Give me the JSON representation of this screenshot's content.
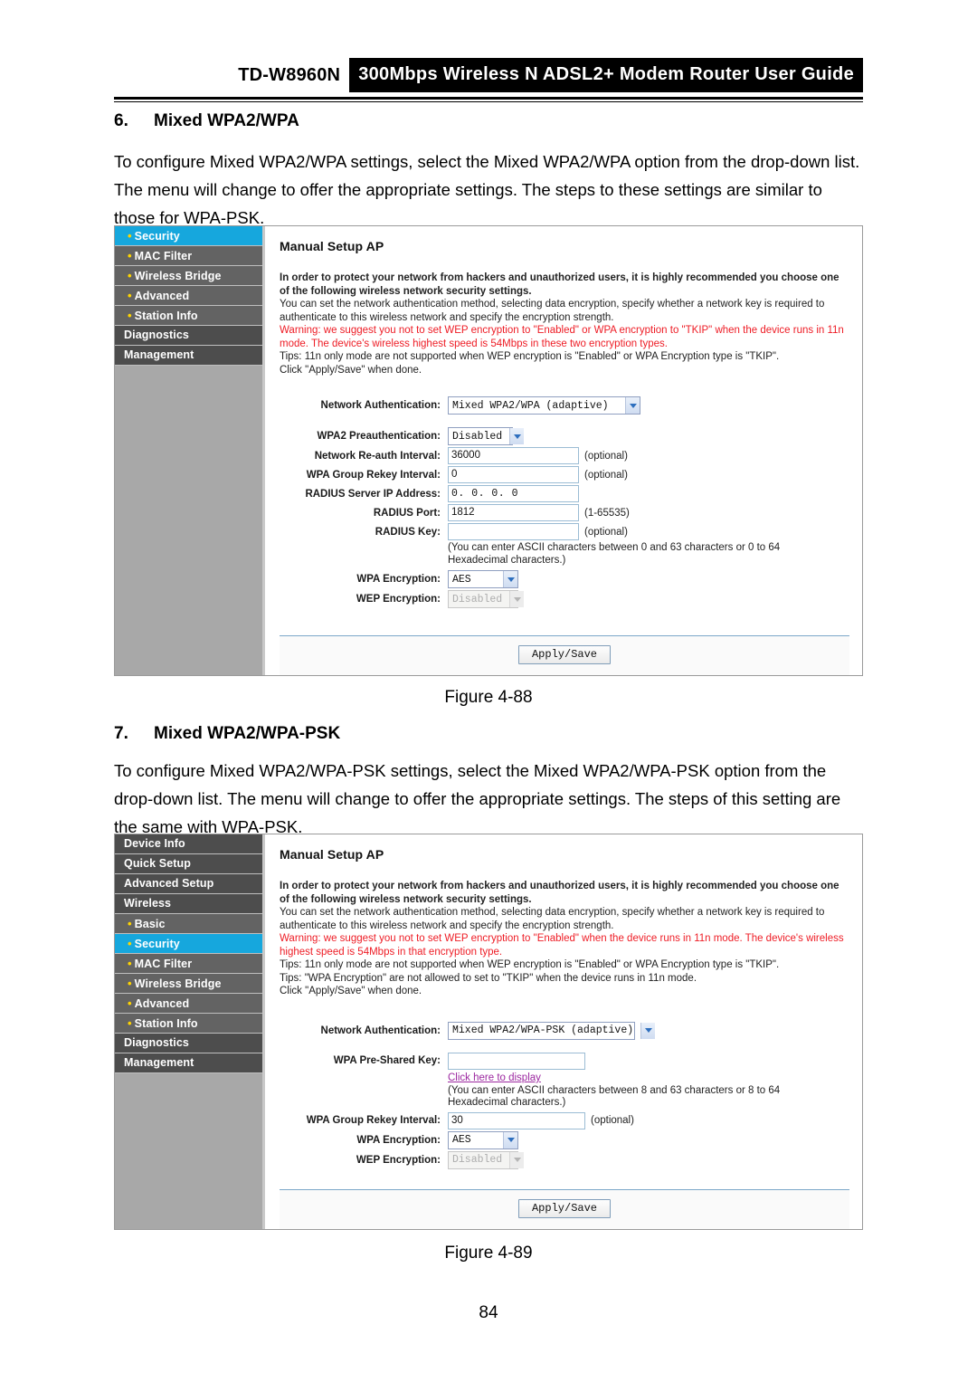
{
  "header": {
    "model": "TD-W8960N",
    "banner": "300Mbps Wireless N ADSL2+ Modem Router User Guide"
  },
  "page_number": "84",
  "sections": [
    {
      "number": "6.",
      "title": "Mixed WPA2/WPA",
      "paragraph": "To configure Mixed WPA2/WPA settings, select the Mixed WPA2/WPA option from the drop-down list. The menu will change to offer the appropriate settings. The steps to these settings are similar to those for WPA-PSK.",
      "figure_caption": "Figure 4-88"
    },
    {
      "number": "7.",
      "title": "Mixed WPA2/WPA-PSK",
      "paragraph": "To configure Mixed WPA2/WPA-PSK settings, select the Mixed WPA2/WPA-PSK option from the drop-down list. The menu will change to offer the appropriate settings. The steps of this setting are the same with WPA-PSK.",
      "figure_caption": "Figure 4-89"
    }
  ],
  "figure88": {
    "sidebar": [
      {
        "label": "Security",
        "sub": true,
        "active": true
      },
      {
        "label": "MAC Filter",
        "sub": true,
        "active": false
      },
      {
        "label": "Wireless Bridge",
        "sub": true,
        "active": false
      },
      {
        "label": "Advanced",
        "sub": true,
        "active": false
      },
      {
        "label": "Station Info",
        "sub": true,
        "active": false
      },
      {
        "label": "Diagnostics",
        "sub": false,
        "active": false
      },
      {
        "label": "Management",
        "sub": false,
        "active": false
      }
    ],
    "panel_title": "Manual Setup AP",
    "blurb": {
      "bold_line": "In order to protect your network from hackers and unauthorized users, it is highly recommended you choose one of the following wireless network security settings.",
      "line2": "You can set the network authentication method, selecting data encryption, specify whether a network key is required to authenticate to this wireless network and specify the encryption strength.",
      "warning": "Warning: we suggest you not to set WEP encryption to \"Enabled\" or WPA encryption to \"TKIP\" when the device runs in 11n mode. The device's wireless highest speed is 54Mbps in these two encryption types.",
      "tip1": "Tips: 11n only mode are not supported when WEP encryption is \"Enabled\" or WPA Encryption type is \"TKIP\".",
      "click": "Click \"Apply/Save\" when done."
    },
    "fields": {
      "network_auth_label": "Network Authentication:",
      "network_auth_value": "Mixed WPA2/WPA (adaptive)",
      "wpa2_preauth_label": "WPA2 Preauthentication:",
      "wpa2_preauth_value": "Disabled",
      "reauth_label": "Network Re-auth Interval:",
      "reauth_value": "36000",
      "reauth_hint": "(optional)",
      "rekey_label": "WPA Group Rekey Interval:",
      "rekey_value": "0",
      "rekey_hint": "(optional)",
      "radius_ip_label": "RADIUS Server IP Address:",
      "radius_ip_value": "0. 0. 0. 0",
      "radius_port_label": "RADIUS Port:",
      "radius_port_value": "1812",
      "radius_port_hint": "(1-65535)",
      "radius_key_label": "RADIUS Key:",
      "radius_key_value": "",
      "radius_key_hint": "(optional)",
      "ascii_note_line1": "(You can enter ASCII characters between 0 and 63 characters or 0 to 64",
      "ascii_note_line2": "Hexadecimal characters.)",
      "wpa_enc_label": "WPA Encryption:",
      "wpa_enc_value": "AES",
      "wep_enc_label": "WEP Encryption:",
      "wep_enc_value": "Disabled"
    },
    "apply_button": "Apply/Save"
  },
  "figure89": {
    "sidebar": [
      {
        "label": "Device Info",
        "sub": false,
        "active": false
      },
      {
        "label": "Quick Setup",
        "sub": false,
        "active": false
      },
      {
        "label": "Advanced Setup",
        "sub": false,
        "active": false
      },
      {
        "label": "Wireless",
        "sub": false,
        "active": false
      },
      {
        "label": "Basic",
        "sub": true,
        "active": false
      },
      {
        "label": "Security",
        "sub": true,
        "active": true
      },
      {
        "label": "MAC Filter",
        "sub": true,
        "active": false
      },
      {
        "label": "Wireless Bridge",
        "sub": true,
        "active": false
      },
      {
        "label": "Advanced",
        "sub": true,
        "active": false
      },
      {
        "label": "Station Info",
        "sub": true,
        "active": false
      },
      {
        "label": "Diagnostics",
        "sub": false,
        "active": false
      },
      {
        "label": "Management",
        "sub": false,
        "active": false
      }
    ],
    "panel_title": "Manual Setup AP",
    "blurb": {
      "bold_line": "In order to protect your network from hackers and unauthorized users, it is highly recommended you choose one of the following wireless network security settings.",
      "line2": "You can set the network authentication method, selecting data encryption, specify whether a network key is required to authenticate to this wireless network and specify the encryption strength.",
      "warning": "Warning: we suggest you not to set WEP encryption to \"Enabled\" when the device runs in 11n mode. The device's wireless highest speed is 54Mbps in that encryption type.",
      "tip1": "Tips: 11n only mode are not supported when WEP encryption is \"Enabled\" or WPA Encryption type is \"TKIP\".",
      "tip2": "Tips: \"WPA Encryption\" are not allowed to set to \"TKIP\" when the device runs in 11n mode.",
      "click": "Click \"Apply/Save\" when done."
    },
    "fields": {
      "network_auth_label": "Network Authentication:",
      "network_auth_value": "Mixed WPA2/WPA-PSK (adaptive)",
      "psk_label": "WPA Pre-Shared Key:",
      "psk_value": "",
      "psk_link": "Click here to display",
      "ascii_note_line1": "(You can enter ASCII characters between 8 and 63 characters or 8 to 64",
      "ascii_note_line2": "Hexadecimal characters.)",
      "rekey_label": "WPA Group Rekey Interval:",
      "rekey_value": "30",
      "rekey_hint": "(optional)",
      "wpa_enc_label": "WPA Encryption:",
      "wpa_enc_value": "AES",
      "wep_enc_label": "WEP Encryption:",
      "wep_enc_value": "Disabled"
    },
    "apply_button": "Apply/Save"
  },
  "colors": {
    "accent_active": "#16a7dd",
    "nav_bg": "#4d4d4d",
    "nav_sub_bg": "#636363",
    "warning_red": "#ee1c25",
    "link_purple": "#9c28a0"
  }
}
